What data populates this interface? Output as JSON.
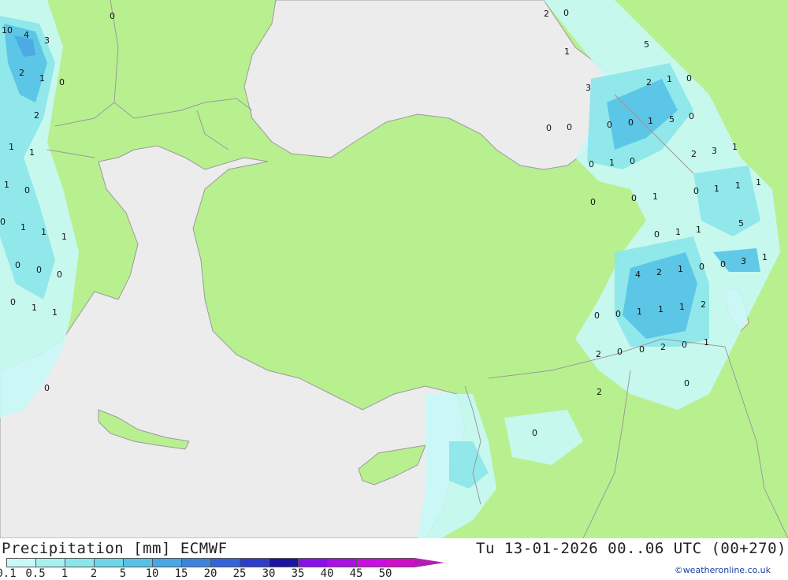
{
  "header": {
    "title": "Precipitation [mm] ECMWF",
    "valid_time": "Tu 13-01-2026 00..06 UTC (00+270)",
    "credit": "©weatheronline.co.uk"
  },
  "legend": {
    "ticks": [
      "0.1",
      "0.5",
      "1",
      "2",
      "5",
      "10",
      "15",
      "20",
      "25",
      "30",
      "35",
      "40",
      "45",
      "50"
    ],
    "colors": [
      "#c8f8f8",
      "#a6f0f0",
      "#8ae6ea",
      "#6fd6e6",
      "#56c2e6",
      "#4aa6e4",
      "#3f84dc",
      "#3464d8",
      "#2e3ec8",
      "#1a14a0",
      "#8a10e8",
      "#a810e4",
      "#c80ee0",
      "#d010c8"
    ],
    "arrow_color": "#b01fb0"
  },
  "map": {
    "colors": {
      "land": "#b8f090",
      "sea": "#ececec",
      "rain_light": "#c8f8f8",
      "rain_mid": "#8ae6ea",
      "rain_heavy": "#56c2e6",
      "border": "#9a9a9a"
    },
    "labels": [
      "0",
      "10",
      "4",
      "3",
      "2",
      "1",
      "0",
      "2",
      "1",
      "1",
      "1",
      "0",
      "1",
      "1",
      "0",
      "0",
      "1",
      "0",
      "0",
      "1",
      "0",
      "1",
      "0",
      "0",
      "2",
      "1",
      "5",
      "3",
      "2",
      "1",
      "0",
      "0",
      "0",
      "1",
      "5",
      "0",
      "0",
      "0",
      "0",
      "1",
      "0",
      "2",
      "3",
      "1",
      "0",
      "1",
      "0",
      "1",
      "1",
      "1",
      "0",
      "5",
      "0",
      "1",
      "1",
      "3",
      "1",
      "0",
      "4",
      "2",
      "1",
      "0",
      "0",
      "0",
      "1",
      "1",
      "1",
      "2",
      "2",
      "0",
      "0",
      "2",
      "0",
      "1",
      "2",
      "0",
      "0"
    ]
  }
}
